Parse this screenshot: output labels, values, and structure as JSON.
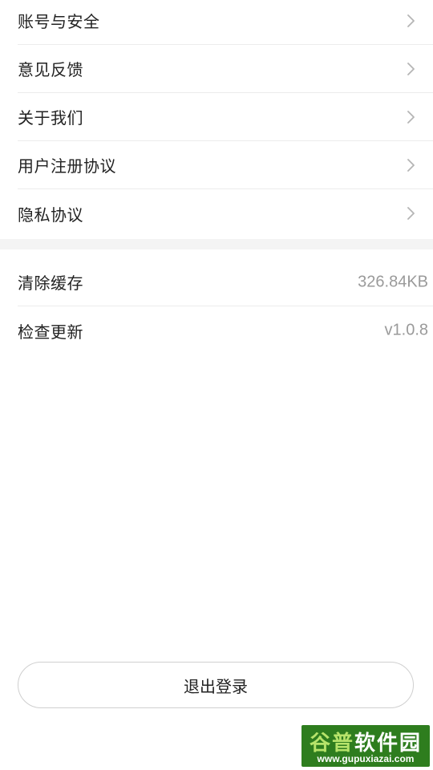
{
  "settings_group_1": [
    {
      "label": "账号与安全",
      "icon": "chevron-right-icon"
    },
    {
      "label": "意见反馈",
      "icon": "chevron-right-icon"
    },
    {
      "label": "关于我们",
      "icon": "chevron-right-icon"
    },
    {
      "label": "用户注册协议",
      "icon": "chevron-right-icon"
    },
    {
      "label": "隐私协议",
      "icon": "chevron-right-icon"
    }
  ],
  "settings_group_2": [
    {
      "label": "清除缓存",
      "value": "326.84KB"
    },
    {
      "label": "检查更新",
      "value": "v1.0.8"
    }
  ],
  "logout_button": {
    "label": "退出登录"
  },
  "watermark": {
    "brand_part1": "谷普",
    "brand_part2": "软件园",
    "url": "www.gupuxiazai.com"
  },
  "colors": {
    "text": "#222222",
    "secondary_text": "#9a9a9a",
    "divider": "#ececec",
    "section_gap": "#f4f4f4",
    "button_border": "#cfcfcf",
    "watermark_bg": "#2e7d1e"
  }
}
